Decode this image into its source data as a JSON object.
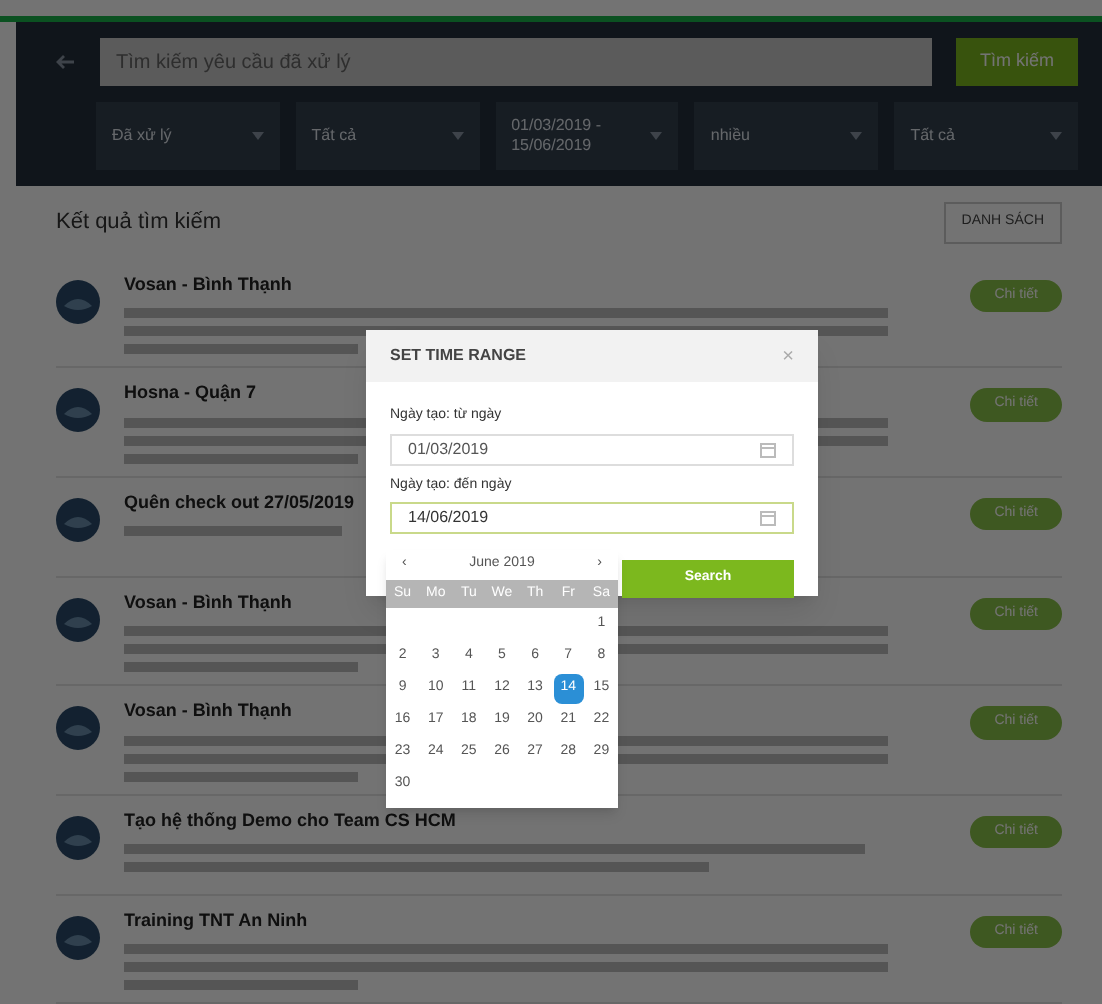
{
  "search": {
    "placeholder": "Tìm kiếm yêu cầu đã xử lý",
    "button": "Tìm kiếm"
  },
  "filters": [
    {
      "value": "Đã xử lý"
    },
    {
      "value": "Tất cả"
    },
    {
      "value": "01/03/2019 - 15/06/2019"
    },
    {
      "value": "nhiều"
    },
    {
      "value": "Tất cả"
    }
  ],
  "results": {
    "title": "Kết quả tìm kiếm",
    "view_button": "DANH SÁCH",
    "items": [
      {
        "title": "Vosan - Bình Thạnh",
        "kind": "three_line",
        "button": "Chi tiết"
      },
      {
        "title": "Hosna - Quận 7",
        "kind": "three_line",
        "button": "Chi tiết"
      },
      {
        "title": "Quên check out 27/05/2019",
        "kind": "one_line",
        "button": "Chi tiết"
      },
      {
        "title": "Vosan - Bình Thạnh",
        "kind": "three_line",
        "button": "Chi tiết"
      },
      {
        "title": "Vosan - Bình Thạnh",
        "kind": "three_line",
        "button": "Chi tiết"
      },
      {
        "title": "Tạo hệ thống Demo cho Team CS HCM",
        "kind": "two_line",
        "button": "Chi tiết"
      },
      {
        "title": "Training TNT An Ninh",
        "kind": "three_line",
        "button": "Chi tiết"
      }
    ]
  },
  "modal": {
    "title": "SET TIME RANGE",
    "close": "×",
    "from_label": "Ngày tạo: từ ngày",
    "from_value": "01/03/2019",
    "to_label": "Ngày tạo: đến ngày",
    "to_value": "14/06/2019",
    "search_button": "Search",
    "calendar": {
      "prev": "‹",
      "month": "June 2019",
      "next": "›",
      "weekdays": [
        "Su",
        "Mo",
        "Tu",
        "We",
        "Th",
        "Fr",
        "Sa"
      ],
      "weeks": [
        [
          {
            "label": "1",
            "selected": false
          }
        ],
        [
          {
            "label": "2",
            "selected": false
          },
          {
            "label": "3",
            "selected": false
          },
          {
            "label": "4",
            "selected": false
          },
          {
            "label": "5",
            "selected": false
          },
          {
            "label": "6",
            "selected": false
          },
          {
            "label": "7",
            "selected": false
          },
          {
            "label": "8",
            "selected": false
          }
        ],
        [
          {
            "label": "9",
            "selected": false
          },
          {
            "label": "10",
            "selected": false
          },
          {
            "label": "11",
            "selected": false
          },
          {
            "label": "12",
            "selected": false
          },
          {
            "label": "13",
            "selected": false
          },
          {
            "label": "14",
            "selected": true
          },
          {
            "label": "15",
            "selected": false
          }
        ],
        [
          {
            "label": "16",
            "selected": false
          },
          {
            "label": "17",
            "selected": false
          },
          {
            "label": "18",
            "selected": false
          },
          {
            "label": "19",
            "selected": false
          },
          {
            "label": "20",
            "selected": false
          },
          {
            "label": "21",
            "selected": false
          },
          {
            "label": "22",
            "selected": false
          }
        ],
        [
          {
            "label": "23",
            "selected": false
          },
          {
            "label": "24",
            "selected": false
          },
          {
            "label": "25",
            "selected": false
          },
          {
            "label": "26",
            "selected": false
          },
          {
            "label": "27",
            "selected": false
          },
          {
            "label": "28",
            "selected": false
          },
          {
            "label": "29",
            "selected": false
          }
        ],
        [
          {
            "label": "30",
            "selected": false
          }
        ]
      ]
    }
  }
}
